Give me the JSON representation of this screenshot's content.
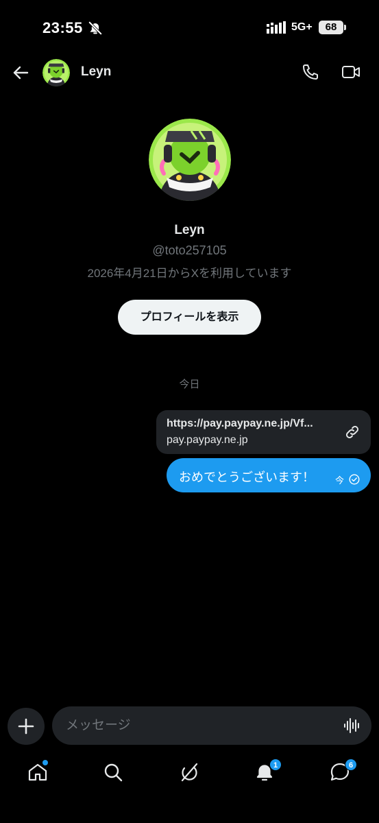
{
  "status_bar": {
    "time": "23:55",
    "network": "5G+",
    "battery": "68"
  },
  "header": {
    "name": "Leyn"
  },
  "profile": {
    "name": "Leyn",
    "handle": "@toto257105",
    "joined": "2026年4月21日からXを利用しています",
    "view_profile_label": "プロフィールを表示"
  },
  "conversation": {
    "date_label": "今日",
    "link_card": {
      "url": "https://pay.paypay.ne.jp/Vf...",
      "domain": "pay.paypay.ne.jp"
    },
    "message": {
      "text": "おめでとうございます！",
      "time": "今"
    }
  },
  "composer": {
    "placeholder": "メッセージ"
  },
  "nav": {
    "notifications_badge": "1",
    "messages_badge": "6"
  },
  "colors": {
    "accent": "#1d9bf0",
    "background": "#000000",
    "secondary_text": "#71767b",
    "card": "#202327"
  }
}
